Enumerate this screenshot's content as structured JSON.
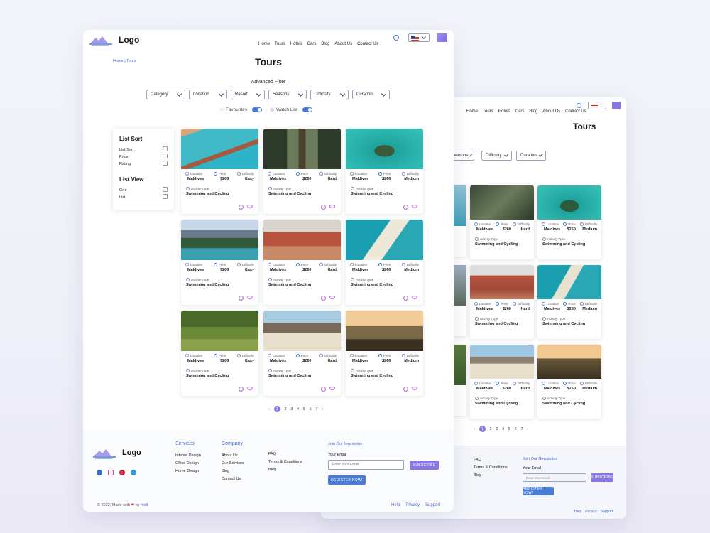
{
  "header": {
    "logo_text": "Logo",
    "nav": [
      "Home",
      "Tours",
      "Hotels",
      "Cars",
      "Blog",
      "About Us",
      "Contact Us"
    ]
  },
  "breadcrumb": "Home | Tours",
  "page_title": "Tours",
  "filter": {
    "heading": "Advanced Filter",
    "dropdowns": [
      "Category",
      "Location",
      "Resort",
      "Seasons",
      "Difficulty",
      "Duration"
    ],
    "toggles": [
      "Favourites",
      "Watch List"
    ]
  },
  "sidebar": {
    "sort_title": "List Sort",
    "sort_items": [
      "List Sort",
      "Price",
      "Rating"
    ],
    "view_title": "List View",
    "view_items": [
      "Grid",
      "List"
    ]
  },
  "card_labels": {
    "location": "Location",
    "price": "Price",
    "difficulty": "Difficulty",
    "activity": "Activity Type"
  },
  "cards": [
    {
      "location": "Maldives",
      "price": "$260",
      "difficulty": "Easy",
      "activity": "Swimming and Cycling",
      "image": "overwater-villas"
    },
    {
      "location": "Maldives",
      "price": "$260",
      "difficulty": "Hard",
      "activity": "Swimming and Cycling",
      "image": "forest-railway"
    },
    {
      "location": "Maldives",
      "price": "$260",
      "difficulty": "Medium",
      "activity": "Swimming and Cycling",
      "image": "island-lagoon"
    },
    {
      "location": "Maldives",
      "price": "$260",
      "difficulty": "Easy",
      "activity": "Swimming and Cycling",
      "image": "mountain-lake"
    },
    {
      "location": "Maldives",
      "price": "$260",
      "difficulty": "Hard",
      "activity": "Swimming and Cycling",
      "image": "red-canyon"
    },
    {
      "location": "Maldives",
      "price": "$260",
      "difficulty": "Medium",
      "activity": "Swimming and Cycling",
      "image": "aerial-beach"
    },
    {
      "location": "Maldives",
      "price": "$260",
      "difficulty": "Easy",
      "activity": "Swimming and Cycling",
      "image": "tea-plantation"
    },
    {
      "location": "Maldives",
      "price": "$260",
      "difficulty": "Hard",
      "activity": "Swimming and Cycling",
      "image": "rocky-beach"
    },
    {
      "location": "Maldives",
      "price": "$260",
      "difficulty": "Medium",
      "activity": "Swimming and Cycling",
      "image": "palm-resort"
    }
  ],
  "pagination": {
    "prev": "‹",
    "pages": [
      "1",
      "2",
      "3",
      "4",
      "5",
      "6",
      "7"
    ],
    "current": "1",
    "next": "›"
  },
  "footer": {
    "logo_text": "Logo",
    "services_title": "Services",
    "services": [
      "Interior Design",
      "Office Design",
      "Home Design"
    ],
    "company_title": "Company",
    "company": [
      "About Us",
      "Our Services",
      "Blog",
      "Contact Us"
    ],
    "misc": [
      "FAQ",
      "Terms & Conditions",
      "Blog"
    ],
    "newsletter_title": "Join Our Newsletter",
    "email_label": "Your Email",
    "email_placeholder": "Enter Your Email",
    "subscribe": "SUBSCRIBE",
    "register": "REGISTER NOW!",
    "copyright_pre": "© 2022, Made with",
    "copyright_by": "by",
    "copyright_author": "frix8",
    "links": [
      "Help",
      "Privacy",
      "Support"
    ],
    "socials": [
      "facebook-icon",
      "instagram-icon",
      "pinterest-icon",
      "twitter-icon"
    ]
  },
  "colors": {
    "accent": "#8a76e0",
    "link": "#4a6fd0",
    "heart": "#e23b3b"
  }
}
